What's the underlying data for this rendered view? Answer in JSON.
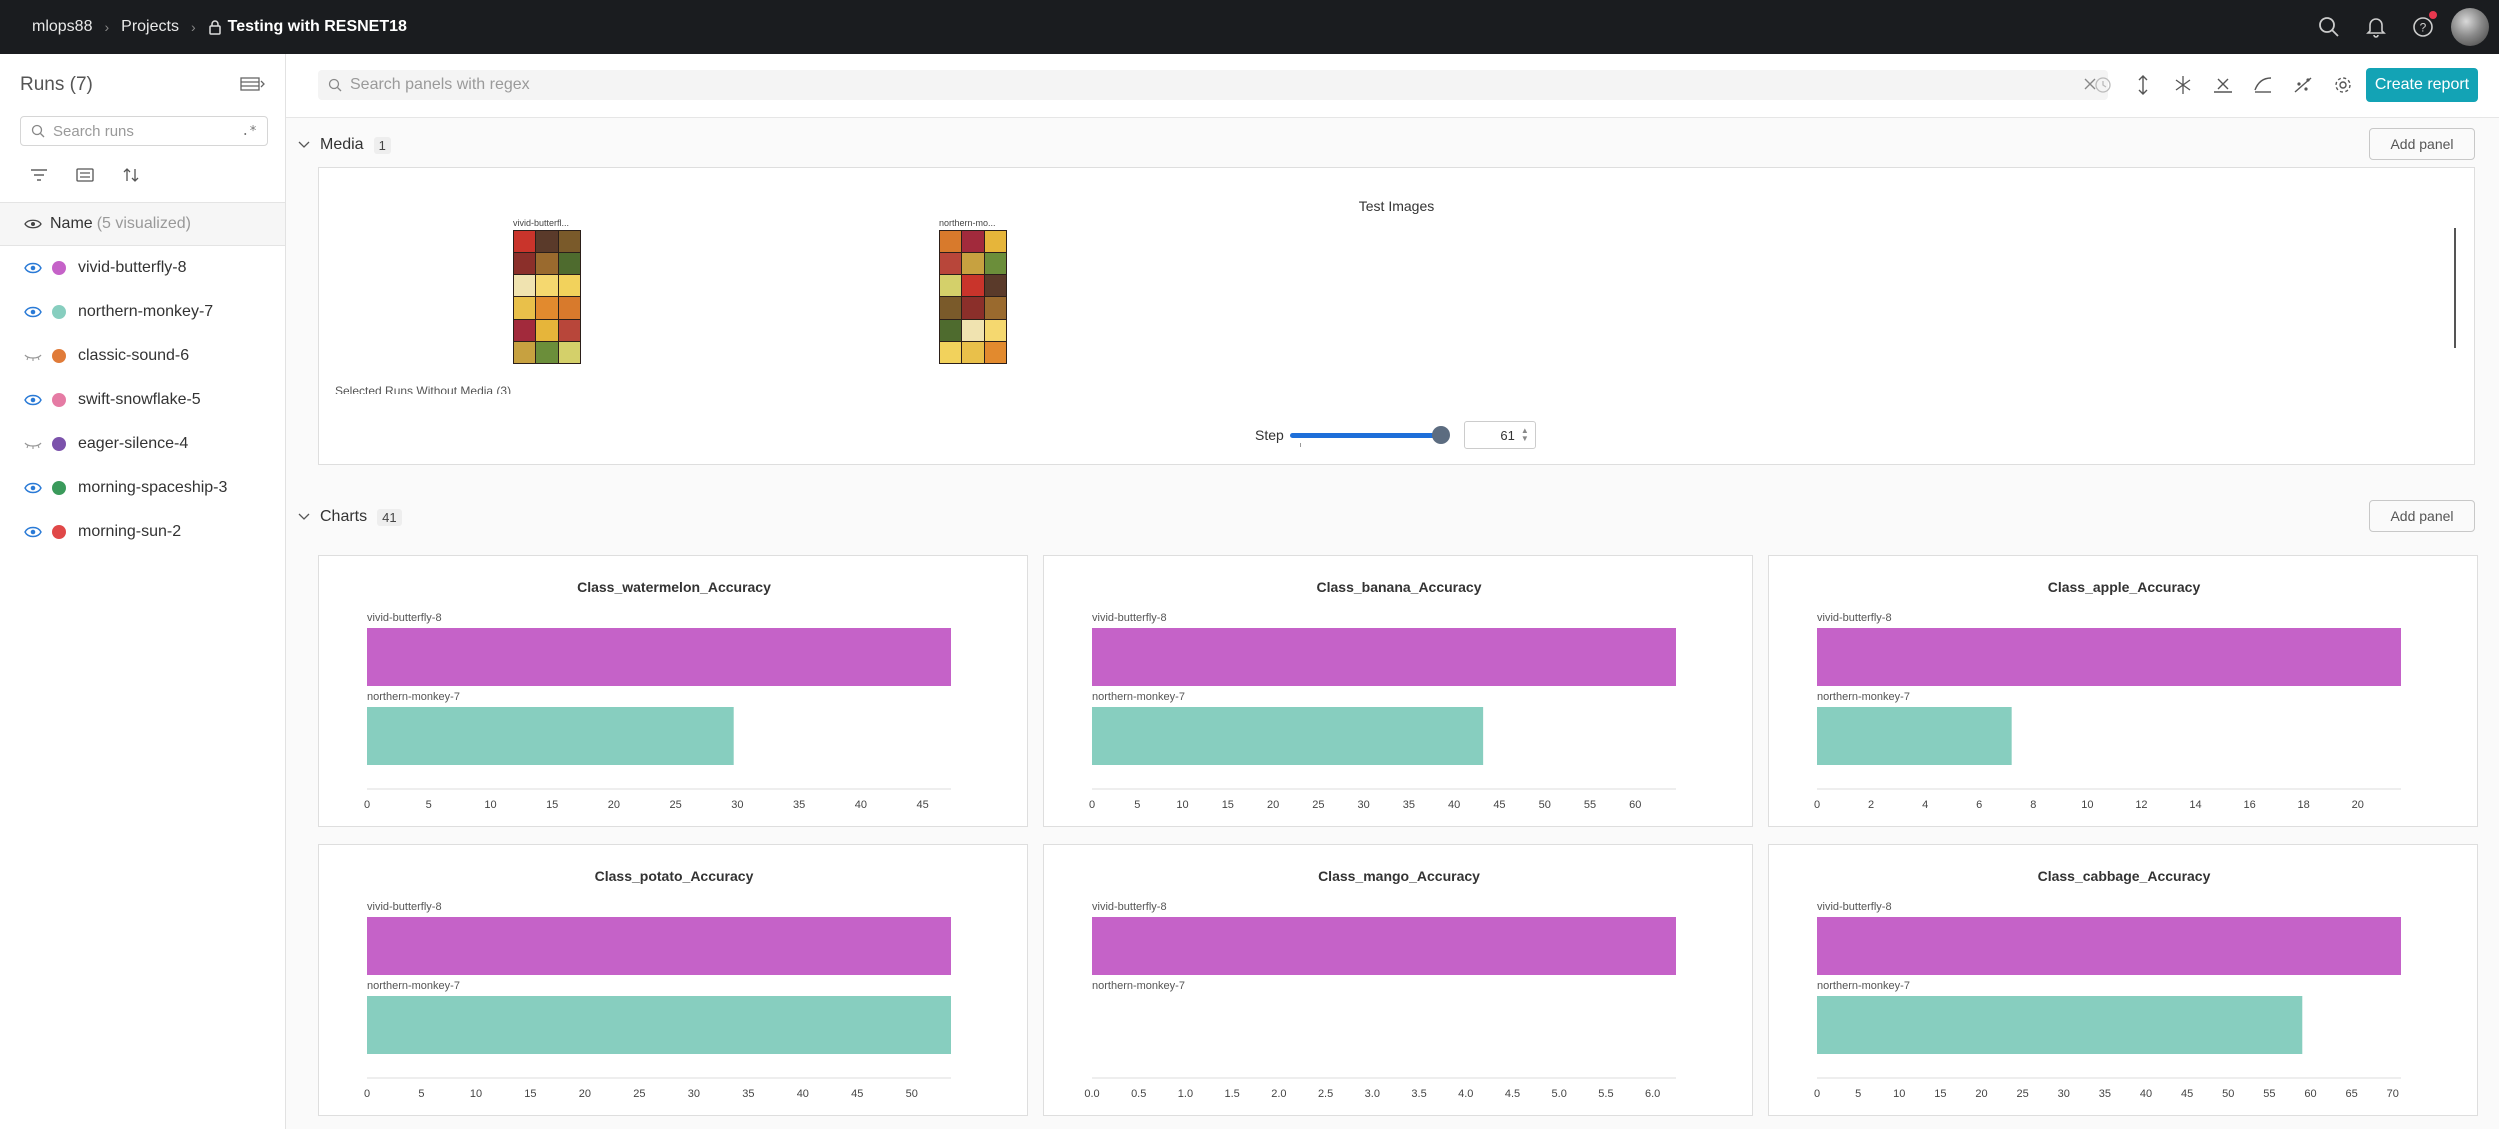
{
  "topbar": {
    "breadcrumb": [
      "mlops88",
      "Projects",
      "Testing with RESNET18"
    ]
  },
  "sidebar": {
    "title": "Runs (7)",
    "search_placeholder": "Search runs",
    "regex_label": ".*",
    "name_header": "Name",
    "visualized_label": "(5 visualized)",
    "runs": [
      {
        "name": "vivid-butterfly-8",
        "color": "#c562c8",
        "visible": true
      },
      {
        "name": "northern-monkey-7",
        "color": "#87cebf",
        "visible": true
      },
      {
        "name": "classic-sound-6",
        "color": "#e07b39",
        "visible": false
      },
      {
        "name": "swift-snowflake-5",
        "color": "#e57ba4",
        "visible": true
      },
      {
        "name": "eager-silence-4",
        "color": "#7b52ab",
        "visible": false
      },
      {
        "name": "morning-spaceship-3",
        "color": "#3a9a5b",
        "visible": true
      },
      {
        "name": "morning-sun-2",
        "color": "#e04848",
        "visible": true
      }
    ]
  },
  "main": {
    "search_placeholder": "Search panels with regex",
    "create_report": "Create report",
    "media_section": {
      "label": "Media",
      "count": "1",
      "add_panel": "Add panel"
    },
    "media_panel": {
      "title": "Test Images",
      "runs": [
        "vivid-butterfl...",
        "northern-mo..."
      ],
      "without_media": "Selected Runs Without Media (3)",
      "step_label": "Step",
      "step_value": "61",
      "step_fraction": 1.0
    },
    "charts_section": {
      "label": "Charts",
      "count": "41",
      "add_panel": "Add panel"
    }
  },
  "colors": {
    "accent": "#13a3b5",
    "series_1": "#c562c8",
    "series_2": "#87cebf"
  },
  "chart_data": [
    {
      "type": "bar",
      "title": "Class_watermelon_Accuracy",
      "categories": [
        "vivid-butterfly-8",
        "northern-monkey-7"
      ],
      "values": [
        47.3,
        29.7
      ],
      "xlim": [
        0,
        47.3
      ],
      "ticks": [
        0,
        5,
        10,
        15,
        20,
        25,
        30,
        35,
        40,
        45
      ],
      "tick_labels": [
        "0",
        "5",
        "10",
        "15",
        "20",
        "25",
        "30",
        "35",
        "40",
        "45"
      ]
    },
    {
      "type": "bar",
      "title": "Class_banana_Accuracy",
      "categories": [
        "vivid-butterfly-8",
        "northern-monkey-7"
      ],
      "values": [
        64.5,
        43.2
      ],
      "xlim": [
        0,
        64.5
      ],
      "ticks": [
        0,
        5,
        10,
        15,
        20,
        25,
        30,
        35,
        40,
        45,
        50,
        55,
        60
      ],
      "tick_labels": [
        "0",
        "5",
        "10",
        "15",
        "20",
        "25",
        "30",
        "35",
        "40",
        "45",
        "50",
        "55",
        "60"
      ]
    },
    {
      "type": "bar",
      "title": "Class_apple_Accuracy",
      "categories": [
        "vivid-butterfly-8",
        "northern-monkey-7"
      ],
      "values": [
        21.6,
        7.2
      ],
      "xlim": [
        0,
        21.6
      ],
      "ticks": [
        0,
        2,
        4,
        6,
        8,
        10,
        12,
        14,
        16,
        18,
        20
      ],
      "tick_labels": [
        "0",
        "2",
        "4",
        "6",
        "8",
        "10",
        "12",
        "14",
        "16",
        "18",
        "20"
      ]
    },
    {
      "type": "bar",
      "title": "Class_potato_Accuracy",
      "categories": [
        "vivid-butterfly-8",
        "northern-monkey-7"
      ],
      "values": [
        53.6,
        53.6
      ],
      "xlim": [
        0,
        53.6
      ],
      "ticks": [
        0,
        5,
        10,
        15,
        20,
        25,
        30,
        35,
        40,
        45,
        50
      ],
      "tick_labels": [
        "0",
        "5",
        "10",
        "15",
        "20",
        "25",
        "30",
        "35",
        "40",
        "45",
        "50"
      ]
    },
    {
      "type": "bar",
      "title": "Class_mango_Accuracy",
      "categories": [
        "vivid-butterfly-8",
        "northern-monkey-7"
      ],
      "values": [
        6.25,
        0
      ],
      "xlim": [
        0,
        6.25
      ],
      "ticks": [
        0,
        0.5,
        1,
        1.5,
        2,
        2.5,
        3,
        3.5,
        4,
        4.5,
        5,
        5.5,
        6
      ],
      "tick_labels": [
        "0.0",
        "0.5",
        "1.0",
        "1.5",
        "2.0",
        "2.5",
        "3.0",
        "3.5",
        "4.0",
        "4.5",
        "5.0",
        "5.5",
        "6.0"
      ]
    },
    {
      "type": "bar",
      "title": "Class_cabbage_Accuracy",
      "categories": [
        "vivid-butterfly-8",
        "northern-monkey-7"
      ],
      "values": [
        71,
        59
      ],
      "xlim": [
        0,
        71
      ],
      "ticks": [
        0,
        5,
        10,
        15,
        20,
        25,
        30,
        35,
        40,
        45,
        50,
        55,
        60,
        65,
        70
      ],
      "tick_labels": [
        "0",
        "5",
        "10",
        "15",
        "20",
        "25",
        "30",
        "35",
        "40",
        "45",
        "50",
        "55",
        "60",
        "65",
        "70"
      ]
    }
  ]
}
